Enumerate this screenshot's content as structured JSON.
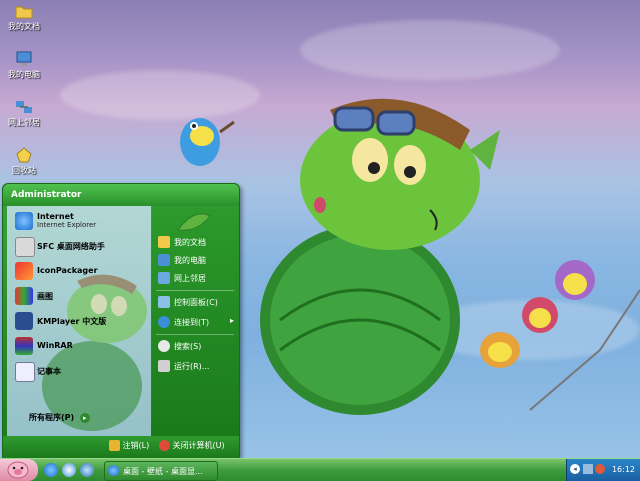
{
  "desktop": {
    "icons": [
      {
        "label": "我的文档",
        "icon": "my-documents-icon"
      },
      {
        "label": "我的电脑",
        "icon": "my-computer-icon"
      },
      {
        "label": "网上邻居",
        "icon": "network-places-icon"
      },
      {
        "label": "回收站",
        "icon": "recycle-bin-icon"
      }
    ]
  },
  "start_menu": {
    "user": "Administrator",
    "pinned": [
      {
        "title": "Internet",
        "subtitle": "Internet Explorer",
        "icon": "internet-explorer-icon"
      }
    ],
    "programs": [
      {
        "label": "SFC 桌面网络助手",
        "icon": "sfc-icon"
      },
      {
        "label": "IconPackager",
        "icon": "iconpackager-icon"
      },
      {
        "label": "画图",
        "icon": "paint-icon"
      },
      {
        "label": "KMPlayer 中文版",
        "icon": "kmplayer-icon"
      },
      {
        "label": "WinRAR",
        "icon": "winrar-icon"
      },
      {
        "label": "记事本",
        "icon": "notepad-icon"
      }
    ],
    "all_programs": "所有程序(P)",
    "right_items": [
      {
        "label": "我的文档",
        "icon": "folder-icon"
      },
      {
        "label": "我的电脑",
        "icon": "computer-icon"
      },
      {
        "label": "网上邻居",
        "icon": "network-icon"
      },
      {
        "label": "控制面板(C)",
        "icon": "control-panel-icon"
      },
      {
        "label": "连接到(T)",
        "icon": "connect-icon"
      },
      {
        "label": "搜索(S)",
        "icon": "search-icon"
      },
      {
        "label": "运行(R)...",
        "icon": "run-icon"
      }
    ],
    "logoff": "注销(L)",
    "shutdown": "关闭计算机(U)"
  },
  "taskbar": {
    "task_label": "桌面 - 壁纸 - 桌面显...",
    "clock": "16:12"
  },
  "colors": {
    "accent": "#2e8a2e",
    "start_button": "#e08aa8",
    "tray": "#1a5fa0"
  }
}
